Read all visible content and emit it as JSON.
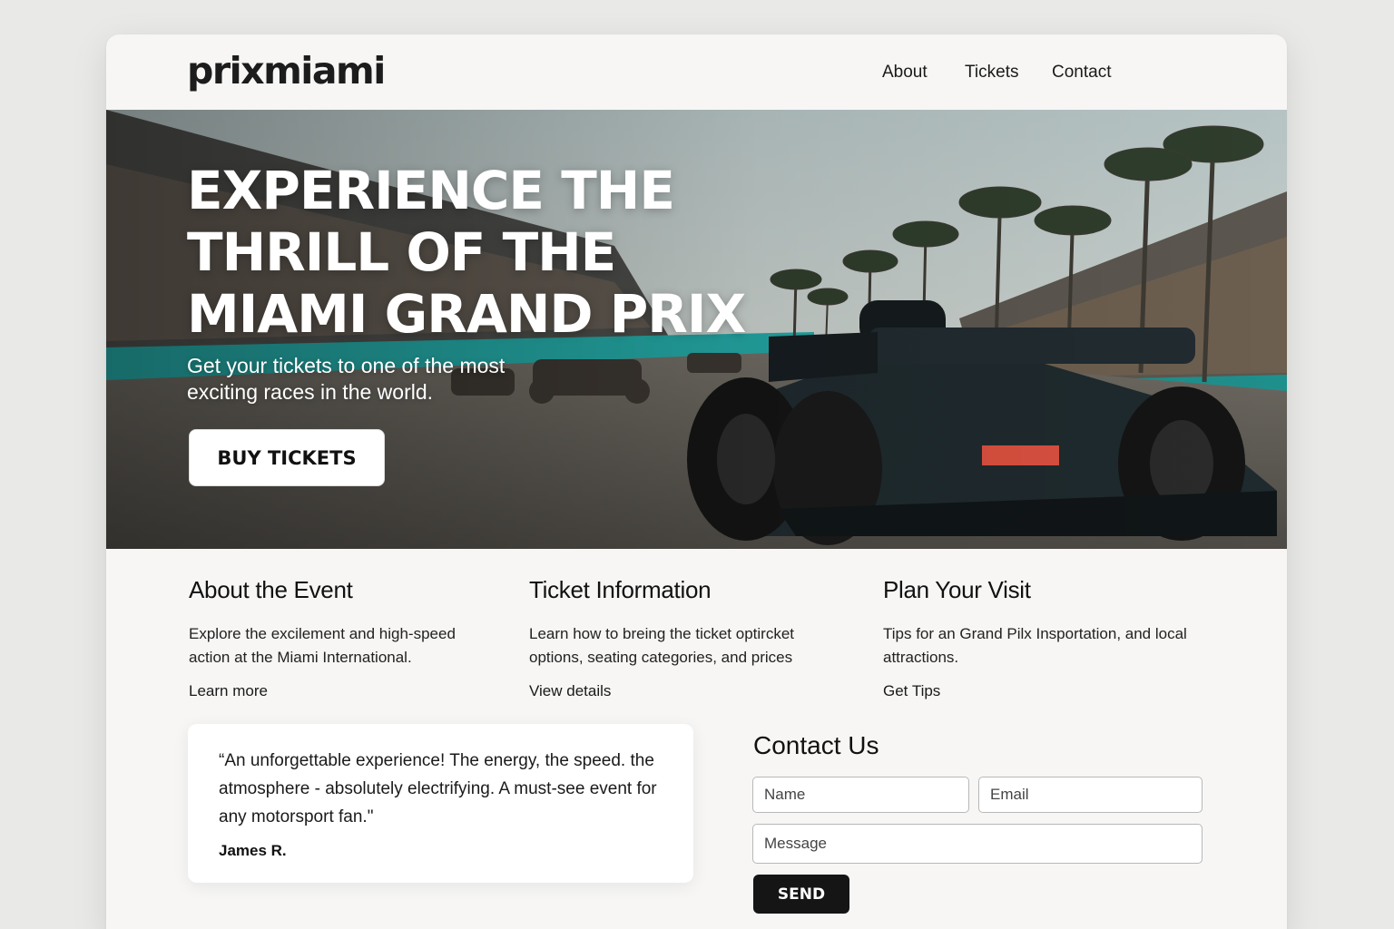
{
  "header": {
    "logo": "prixmiami",
    "nav": [
      "About",
      "Tickets",
      "Contact"
    ]
  },
  "hero": {
    "title": "EXPERIENCE THE\nTHRILL OF THE\nMIAMI GRAND PRIX",
    "subtitle": "Get your tickets to one of the most exciting races in the world.",
    "button": "BUY TICKETS",
    "image_icon": "race-car-photo"
  },
  "columns": [
    {
      "title": "About the Event",
      "text": "Explore the excilement and high-speed action at the Miami International.",
      "link": "Learn more"
    },
    {
      "title": "Ticket Information",
      "text": "Learn how to breing the ticket optircket options, seating categories, and prices",
      "link": "View details"
    },
    {
      "title": "Plan Your Visit",
      "text": "Tips for an Grand Pilx Insportation, and local attractions.",
      "link": "Get Tips"
    }
  ],
  "testimonial": {
    "quote": "“An unforgettable experience! The energy, the speed. the atmosphere - absolutely electrifying. A must-see event for any motorsport fan.\"",
    "author": "James R."
  },
  "contact": {
    "title": "Contact Us",
    "name_placeholder": "Name",
    "email_placeholder": "Email",
    "message_placeholder": "Message",
    "send_label": "SEND"
  },
  "colors": {
    "page_bg": "#e9e9e7",
    "card_bg": "#f7f6f4",
    "button_dark": "#151515",
    "track_teal": "#23a3a0",
    "car_accent": "#d9503f"
  }
}
